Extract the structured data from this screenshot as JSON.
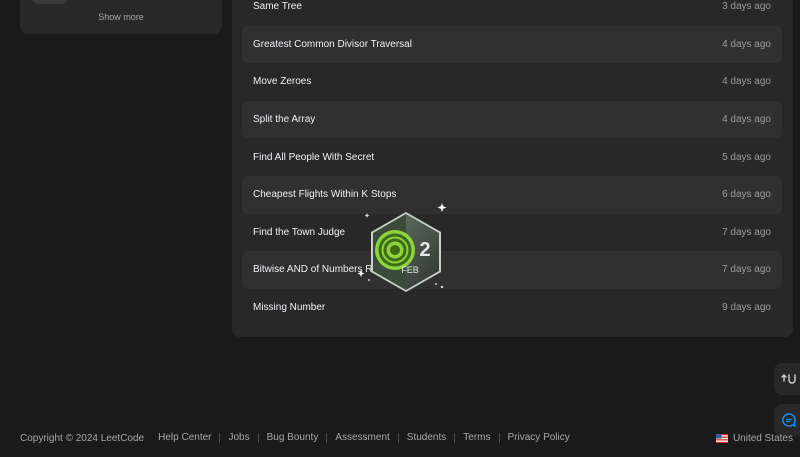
{
  "sidebar": {
    "show_more": "Show more"
  },
  "recent": [
    {
      "title": "Same Tree",
      "time": "3 days ago"
    },
    {
      "title": "Greatest Common Divisor Traversal",
      "time": "4 days ago"
    },
    {
      "title": "Move Zeroes",
      "time": "4 days ago"
    },
    {
      "title": "Split the Array",
      "time": "4 days ago"
    },
    {
      "title": "Find All People With Secret",
      "time": "5 days ago"
    },
    {
      "title": "Cheapest Flights Within K Stops",
      "time": "6 days ago"
    },
    {
      "title": "Find the Town Judge",
      "time": "7 days ago"
    },
    {
      "title": "Bitwise AND of Numbers Range",
      "time": "7 days ago"
    },
    {
      "title": "Missing Number",
      "time": "9 days ago"
    }
  ],
  "badge": {
    "day": "2",
    "month": "FEB"
  },
  "footer": {
    "copyright": "Copyright © 2024 LeetCode",
    "links": [
      "Help Center",
      "Jobs",
      "Bug Bounty",
      "Assessment",
      "Students",
      "Terms",
      "Privacy Policy"
    ],
    "region": "United States"
  },
  "icons": {
    "side_top": "switch-layout-icon",
    "side_bottom": "feedback-chat-icon"
  },
  "colors": {
    "background": "#1a1a1a",
    "card": "#282828",
    "badge_green": "#7ed321",
    "chat_blue": "#1a90ff"
  }
}
